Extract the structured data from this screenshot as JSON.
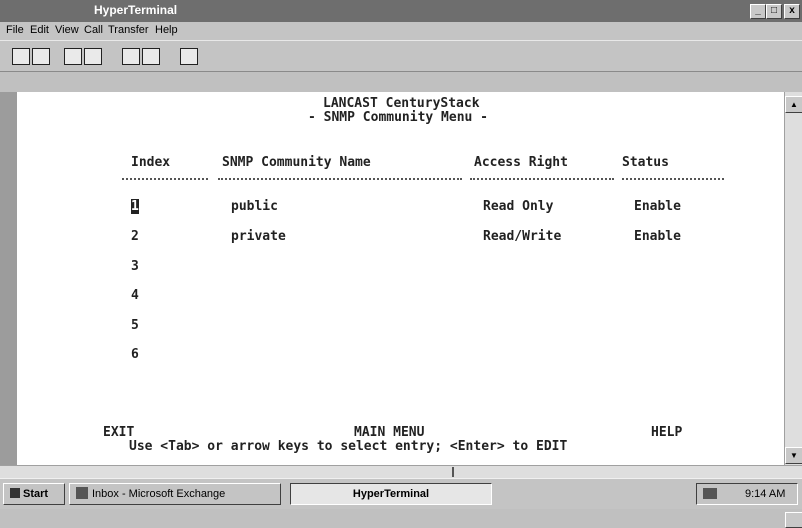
{
  "window": {
    "title": "HyperTerminal"
  },
  "window_controls": {
    "minimize": "_",
    "maximize": "□",
    "close": "x"
  },
  "menu": [
    "File",
    "Edit",
    "View",
    "Call",
    "Transfer",
    "Help"
  ],
  "terminal": {
    "header1": "LANCAST CenturyStack",
    "header2": "- SNMP Community Menu -",
    "columns": [
      "Index",
      "SNMP Community Name",
      "Access Right",
      "Status"
    ],
    "rows": [
      {
        "index": "1",
        "name": "public",
        "access": "Read Only",
        "status": "Enable"
      },
      {
        "index": "2",
        "name": "private",
        "access": "Read/Write",
        "status": "Enable"
      },
      {
        "index": "3",
        "name": "",
        "access": "",
        "status": ""
      },
      {
        "index": "4",
        "name": "",
        "access": "",
        "status": ""
      },
      {
        "index": "5",
        "name": "",
        "access": "",
        "status": ""
      },
      {
        "index": "6",
        "name": "",
        "access": "",
        "status": ""
      }
    ],
    "footer": {
      "exit": "EXIT",
      "main": "MAIN MENU",
      "help": "HELP",
      "hint": "Use <Tab> or arrow keys to select entry; <Enter> to EDIT"
    }
  },
  "taskbar": {
    "start": "Start",
    "items": [
      "Inbox - Microsoft Exchange",
      "HyperTerminal"
    ],
    "clock": "9:14 AM"
  }
}
